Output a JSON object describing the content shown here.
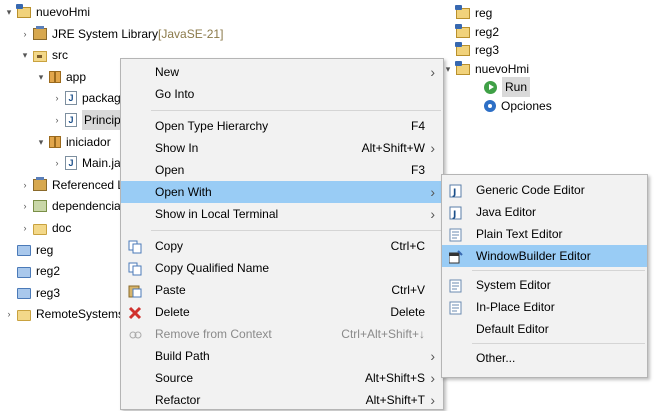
{
  "left_tree": [
    {
      "arrow": "▾",
      "icon": "project-icon",
      "label": "nuevoHmi",
      "indent": 0
    },
    {
      "arrow": "›",
      "icon": "jre-library-icon",
      "label": "JRE System Library",
      "suffix": " [JavaSE-21]",
      "indent": 1
    },
    {
      "arrow": "▾",
      "icon": "src-folder-icon",
      "label": "src",
      "indent": 1
    },
    {
      "arrow": "▾",
      "icon": "package-icon",
      "label": "app",
      "indent": 2
    },
    {
      "arrow": "›",
      "icon": "java-file-icon",
      "label": "packag",
      "indent": 3
    },
    {
      "arrow": "›",
      "icon": "java-file-icon",
      "label": "Princip",
      "indent": 3,
      "selected": true
    },
    {
      "arrow": "▾",
      "icon": "package-icon",
      "label": "iniciador",
      "indent": 2
    },
    {
      "arrow": "›",
      "icon": "java-file-icon",
      "label": "Main.ja",
      "indent": 3
    },
    {
      "arrow": "›",
      "icon": "library-icon",
      "label": "Referenced L",
      "indent": 1
    },
    {
      "arrow": "›",
      "icon": "jar-folder-icon",
      "label": "dependencia",
      "indent": 1
    },
    {
      "arrow": "›",
      "icon": "folder-icon",
      "label": "doc",
      "indent": 1
    },
    {
      "arrow": "",
      "icon": "blue-folder-icon",
      "label": "reg",
      "indent": 0
    },
    {
      "arrow": "",
      "icon": "blue-folder-icon",
      "label": "reg2",
      "indent": 0
    },
    {
      "arrow": "",
      "icon": "blue-folder-icon",
      "label": "reg3",
      "indent": 0
    },
    {
      "arrow": "›",
      "icon": "folder-icon",
      "label": "RemoteSystems",
      "indent": 0
    }
  ],
  "right_tree": [
    {
      "icon": "project-icon",
      "label": "reg",
      "arrow": ""
    },
    {
      "icon": "project-icon",
      "label": "reg2",
      "arrow": ""
    },
    {
      "icon": "project-icon",
      "label": "reg3",
      "arrow": ""
    },
    {
      "icon": "project-icon",
      "label": "nuevoHmi",
      "arrow": "▾"
    },
    {
      "icon": "run-icon",
      "label": "Run",
      "arrow": "",
      "selected": true
    },
    {
      "icon": "settings-icon",
      "label": "Opciones",
      "arrow": ""
    }
  ],
  "context_menu": {
    "items": [
      {
        "label": "New",
        "accel": "",
        "submenu": true
      },
      {
        "label": "Go Into",
        "accel": ""
      },
      {
        "sep": true
      },
      {
        "label": "Open Type Hierarchy",
        "accel": "F4"
      },
      {
        "label": "Show In",
        "accel": "Alt+Shift+W",
        "submenu": true
      },
      {
        "label": "Open",
        "accel": "F3"
      },
      {
        "label": "Open With",
        "accel": "",
        "submenu": true,
        "highlighted": true
      },
      {
        "label": "Show in Local Terminal",
        "accel": "",
        "submenu": true
      },
      {
        "sep": true
      },
      {
        "label": "Copy",
        "accel": "Ctrl+C",
        "icon": "copy-icon"
      },
      {
        "label": "Copy Qualified Name",
        "accel": "",
        "icon": "copy-qualified-icon"
      },
      {
        "label": "Paste",
        "accel": "Ctrl+V",
        "icon": "paste-icon"
      },
      {
        "label": "Delete",
        "accel": "Delete",
        "icon": "delete-icon"
      },
      {
        "label": "Remove from Context",
        "accel": "Ctrl+Alt+Shift+↓",
        "icon": "remove-context-icon",
        "disabled": true
      },
      {
        "label": "Build Path",
        "accel": "",
        "submenu": true
      },
      {
        "label": "Source",
        "accel": "Alt+Shift+S",
        "submenu": true
      },
      {
        "label": "Refactor",
        "accel": "Alt+Shift+T",
        "submenu": true
      }
    ]
  },
  "open_with_menu": {
    "items": [
      {
        "label": "Generic Code Editor",
        "icon": "generic-editor-icon"
      },
      {
        "label": "Java Editor",
        "icon": "java-editor-icon"
      },
      {
        "label": "Plain Text Editor",
        "icon": "text-editor-icon"
      },
      {
        "label": "WindowBuilder Editor",
        "icon": "windowbuilder-icon",
        "highlighted": true
      },
      {
        "sep": true
      },
      {
        "label": "System Editor",
        "icon": "system-editor-icon"
      },
      {
        "label": "In-Place Editor",
        "icon": "inplace-editor-icon"
      },
      {
        "label": "Default Editor",
        "icon": ""
      },
      {
        "sep": true
      },
      {
        "label": "Other...",
        "icon": ""
      }
    ]
  }
}
